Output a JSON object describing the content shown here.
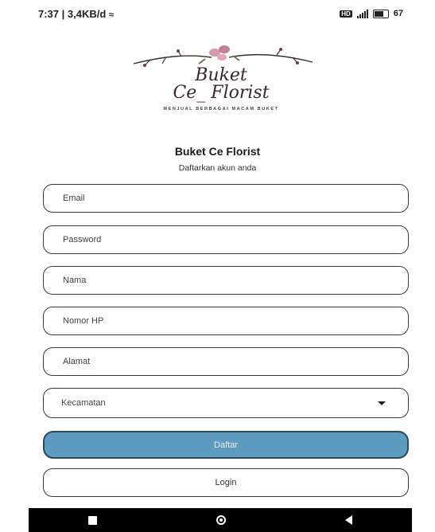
{
  "status_bar": {
    "left_text": "7:37 | 3,4KB/d",
    "network_badge": "HD",
    "battery_text": "67",
    "icons": [
      "nfc-icon",
      "signal-icon",
      "battery-icon"
    ]
  },
  "logo": {
    "line1": "Buket",
    "line2": "Ce_ Florist",
    "tagline": "MENJUAL BERBAGAI MACAM BUKET"
  },
  "form": {
    "title": "Buket Ce Florist",
    "subtitle": "Daftarkan akun anda",
    "fields": {
      "email": {
        "placeholder": "Email",
        "value": ""
      },
      "password": {
        "placeholder": "Password",
        "value": ""
      },
      "nama": {
        "placeholder": "Nama",
        "value": ""
      },
      "nomor_hp": {
        "placeholder": "Nomor HP",
        "value": ""
      },
      "alamat": {
        "placeholder": "Alamat",
        "value": ""
      }
    },
    "kecamatan_label": "Kecamatan",
    "daftar_label": "Daftar",
    "login_label": "Login"
  },
  "colors": {
    "primary_button": "#5e9bc0",
    "primary_border": "#2c4a5c",
    "field_border": "#3a3a3a",
    "nav_bar": "#000000"
  },
  "nav_bar": {
    "icons": [
      "recents-icon",
      "home-icon",
      "back-icon"
    ]
  }
}
